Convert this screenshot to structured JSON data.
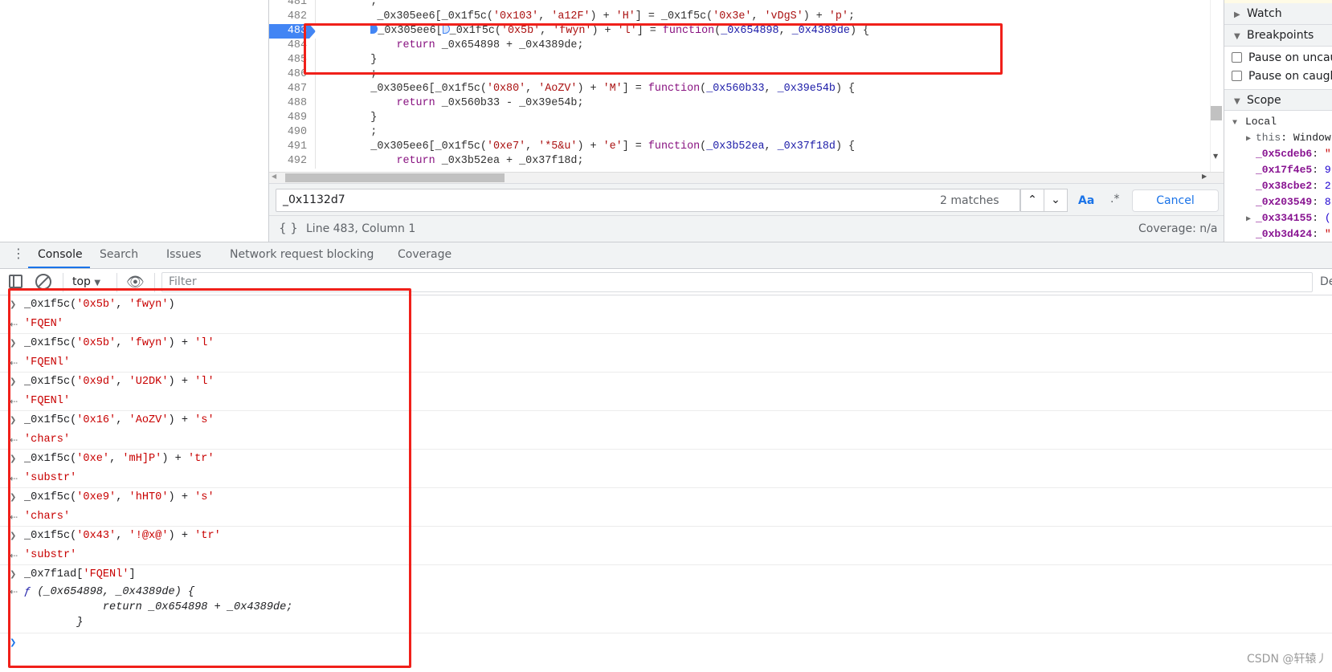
{
  "editor": {
    "current_line": "483",
    "lines": [
      {
        "num": "481",
        "tokens": [
          [
            "        ;",
            "p"
          ]
        ]
      },
      {
        "num": "482",
        "tokens": [
          [
            "         _0x305ee6[_0x1f5c(",
            "p"
          ],
          [
            "'0x103'",
            "s"
          ],
          [
            ", ",
            "p"
          ],
          [
            "'a12F'",
            "s"
          ],
          [
            ") + ",
            "p"
          ],
          [
            "'H'",
            "s"
          ],
          [
            "] = _0x1f5c(",
            "p"
          ],
          [
            "'0x3e'",
            "s"
          ],
          [
            ", ",
            "p"
          ],
          [
            "'vDgS'",
            "s"
          ],
          [
            ") + ",
            "p"
          ],
          [
            "'p'",
            "s"
          ],
          [
            ";",
            "p"
          ]
        ]
      },
      {
        "num": "483",
        "bp": true,
        "tokens": [
          [
            "        ",
            "p"
          ],
          [
            "#BP",
            "m"
          ],
          [
            "_0x305ee6[",
            "p"
          ],
          [
            "#BPO",
            "m"
          ],
          [
            "_0x1f5c(",
            "p"
          ],
          [
            "'0x5b'",
            "s"
          ],
          [
            ", ",
            "p"
          ],
          [
            "'fwyn'",
            "s"
          ],
          [
            ") + ",
            "p"
          ],
          [
            "'l'",
            "s"
          ],
          [
            "] = ",
            "p"
          ],
          [
            "function",
            "k"
          ],
          [
            "(",
            "p"
          ],
          [
            "_0x654898",
            "v"
          ],
          [
            ", ",
            "p"
          ],
          [
            "_0x4389de",
            "v"
          ],
          [
            ") {",
            "p"
          ]
        ]
      },
      {
        "num": "484",
        "tokens": [
          [
            "            ",
            "p"
          ],
          [
            "return",
            "k"
          ],
          [
            " _0x654898 + _0x4389de;",
            "p"
          ]
        ]
      },
      {
        "num": "485",
        "tokens": [
          [
            "        }",
            "p"
          ]
        ]
      },
      {
        "num": "486",
        "tokens": [
          [
            "        ;",
            "p"
          ]
        ]
      },
      {
        "num": "487",
        "tokens": [
          [
            "        _0x305ee6[_0x1f5c(",
            "p"
          ],
          [
            "'0x80'",
            "s"
          ],
          [
            ", ",
            "p"
          ],
          [
            "'AoZV'",
            "s"
          ],
          [
            ") + ",
            "p"
          ],
          [
            "'M'",
            "s"
          ],
          [
            "] = ",
            "p"
          ],
          [
            "function",
            "k"
          ],
          [
            "(",
            "p"
          ],
          [
            "_0x560b33",
            "v"
          ],
          [
            ", ",
            "p"
          ],
          [
            "_0x39e54b",
            "v"
          ],
          [
            ") {",
            "p"
          ]
        ]
      },
      {
        "num": "488",
        "tokens": [
          [
            "            ",
            "p"
          ],
          [
            "return",
            "k"
          ],
          [
            " _0x560b33 - _0x39e54b;",
            "p"
          ]
        ]
      },
      {
        "num": "489",
        "tokens": [
          [
            "        }",
            "p"
          ]
        ]
      },
      {
        "num": "490",
        "tokens": [
          [
            "        ;",
            "p"
          ]
        ]
      },
      {
        "num": "491",
        "tokens": [
          [
            "        _0x305ee6[_0x1f5c(",
            "p"
          ],
          [
            "'0xe7'",
            "s"
          ],
          [
            ", ",
            "p"
          ],
          [
            "'*5&u'",
            "s"
          ],
          [
            ") + ",
            "p"
          ],
          [
            "'e'",
            "s"
          ],
          [
            "] = ",
            "p"
          ],
          [
            "function",
            "k"
          ],
          [
            "(",
            "p"
          ],
          [
            "_0x3b52ea",
            "v"
          ],
          [
            ", ",
            "p"
          ],
          [
            "_0x37f18d",
            "v"
          ],
          [
            ") {",
            "p"
          ]
        ]
      },
      {
        "num": "492",
        "tokens": [
          [
            "            ",
            "p"
          ],
          [
            "return",
            "k"
          ],
          [
            " _0x3b52ea + _0x37f18d;",
            "p"
          ]
        ]
      }
    ]
  },
  "search": {
    "value": "_0x1132d7",
    "matches": "2 matches",
    "case_label": "Aa",
    "regex_label": ".*",
    "cancel_label": "Cancel"
  },
  "status": {
    "braces": "{ }",
    "position": "Line 483, Column 1",
    "coverage": "Coverage: n/a"
  },
  "sidebar": {
    "watch": "Watch",
    "breakpoints": "Breakpoints",
    "pause_uncaught": "Pause on uncaught exceptions",
    "pause_caught": "Pause on caught exceptions",
    "scope": "Scope",
    "local": "Local",
    "vars": [
      {
        "name": "this",
        "value": "Window",
        "expandable": true,
        "plain": true
      },
      {
        "name": "_0x5cdeb6",
        "value": "\""
      },
      {
        "name": "_0x17f4e5",
        "value": "9"
      },
      {
        "name": "_0x38cbe2",
        "value": "2"
      },
      {
        "name": "_0x203549",
        "value": "8"
      },
      {
        "name": "_0x334155",
        "value": "(",
        "expandable": true
      },
      {
        "name": "_0xb3d424",
        "value": "\""
      }
    ]
  },
  "drawer": {
    "tabs": [
      "Console",
      "Search",
      "Issues",
      "Network request blocking",
      "Coverage"
    ],
    "active": "Console"
  },
  "console_toolbar": {
    "context": "top",
    "filter_placeholder": "Filter",
    "levels": "De"
  },
  "console": {
    "entries": [
      {
        "input": [
          "_0x1f5c('0x5b', 'fwyn')"
        ],
        "output": "'FQEN'"
      },
      {
        "input": [
          "_0x1f5c('0x5b', 'fwyn') + 'l'"
        ],
        "output": "'FQENl'"
      },
      {
        "input": [
          "_0x1f5c('0x9d', 'U2DK') + 'l'"
        ],
        "output": "'FQENl'"
      },
      {
        "input": [
          "_0x1f5c('0x16', 'AoZV') + 's'"
        ],
        "output": "'chars'"
      },
      {
        "input": [
          "_0x1f5c('0xe', 'mH]P') + 'tr'"
        ],
        "output": "'substr'"
      },
      {
        "input": [
          "_0x1f5c('0xe9', 'hHT0') + 's'"
        ],
        "output": "'chars'"
      },
      {
        "input": [
          "_0x1f5c('0x43', '!@x@') + 'tr'"
        ],
        "output": "'substr'"
      },
      {
        "input": [
          "_0x7f1ad['FQENl']"
        ],
        "output": null
      }
    ],
    "function_output": {
      "f": "ƒ",
      "lines": [
        " (_0x654898, _0x4389de) {",
        "            return _0x654898 + _0x4389de;",
        "        }"
      ]
    }
  },
  "watermark": "CSDN @轩辕丿",
  "colors": {
    "annotation_box": "#f0201a",
    "accent": "#1a73e8",
    "breakpoint": "#4285f4",
    "string": "#c80000"
  }
}
